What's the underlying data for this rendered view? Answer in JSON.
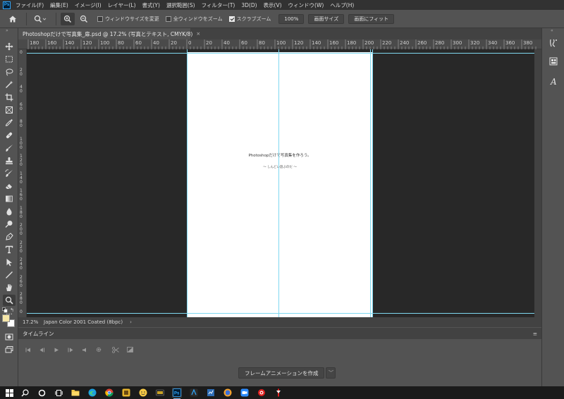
{
  "app": {
    "logo": "Ps"
  },
  "menu": [
    "ファイル(F)",
    "編集(E)",
    "イメージ(I)",
    "レイヤー(L)",
    "書式(Y)",
    "選択範囲(S)",
    "フィルター(T)",
    "3D(D)",
    "表示(V)",
    "ウィンドウ(W)",
    "ヘルプ(H)"
  ],
  "options": {
    "resize_windows": "ウィンドウサイズを変更",
    "zoom_all": "全ウィンドウをズーム",
    "scrubby_zoom": "スクラブズーム",
    "zoom_value": "100%",
    "fit_screen": "画面サイズ",
    "fill_screen": "画面にフィット"
  },
  "document": {
    "tab_title": "Photoshopだけで写真集_扉.psd @ 17.2% (写真とテキスト, CMYK/8)",
    "close": "×",
    "title_text": "Photoshopだけで写真集を作ろう。",
    "subtitle_text": "～ しんどい遊ぶのだ ～"
  },
  "ruler": {
    "top": [
      "180",
      "160",
      "140",
      "120",
      "100",
      "80",
      "60",
      "40",
      "20",
      "0",
      "20",
      "40",
      "60",
      "80",
      "100",
      "120",
      "140",
      "160",
      "180",
      "200",
      "220",
      "240",
      "260",
      "280",
      "300",
      "320",
      "340",
      "360",
      "380"
    ],
    "left": [
      "0",
      "2\n0",
      "4\n0",
      "6\n0",
      "8\n0",
      "1\n0\n0",
      "1\n2\n0",
      "1\n4\n0",
      "1\n6\n0",
      "1\n8\n0",
      "2\n0\n0",
      "2\n2\n0",
      "2\n4\n0",
      "2\n6\n0",
      "2\n8\n0",
      "0"
    ]
  },
  "status": {
    "zoom": "17.2%",
    "profile": "Japan Color 2001 Coated (8bpc)",
    "arrow": "›"
  },
  "timeline": {
    "title": "タイムライン",
    "menu": "≡",
    "create_button": "フレームアニメーションを作成",
    "dropdown": "﹀"
  },
  "colors": {
    "foreground": "#f5e6a8",
    "background": "#ffffff",
    "guide": "#7fd8f0",
    "accent": "#31a8ff"
  }
}
